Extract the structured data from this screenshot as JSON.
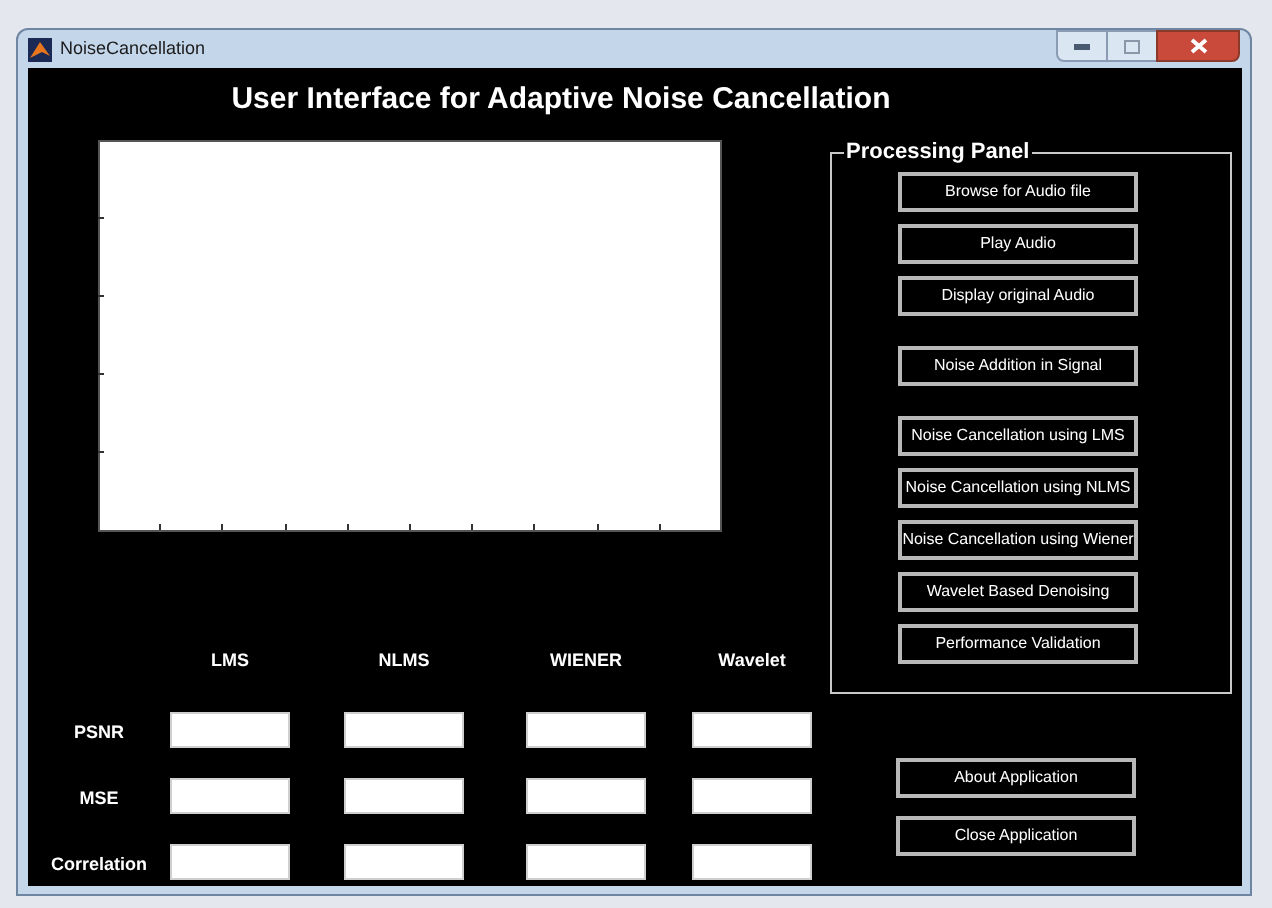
{
  "window": {
    "title": "NoiseCancellation"
  },
  "heading": "User Interface for Adaptive Noise Cancellation",
  "processing_panel": {
    "title": "Processing Panel",
    "groups": [
      [
        "Browse for Audio file",
        "Play Audio",
        "Display original Audio"
      ],
      [
        "Noise Addition in Signal"
      ],
      [
        "Noise Cancellation using LMS",
        "Noise Cancellation using NLMS",
        "Noise Cancellation using Wiener",
        "Wavelet Based Denoising",
        "Performance Validation"
      ]
    ]
  },
  "metrics": {
    "columns": [
      "LMS",
      "NLMS",
      "WIENER",
      "Wavelet"
    ],
    "rows": [
      "PSNR",
      "MSE",
      "Correlation"
    ]
  },
  "application_buttons": [
    "About Application",
    "Close Application"
  ]
}
